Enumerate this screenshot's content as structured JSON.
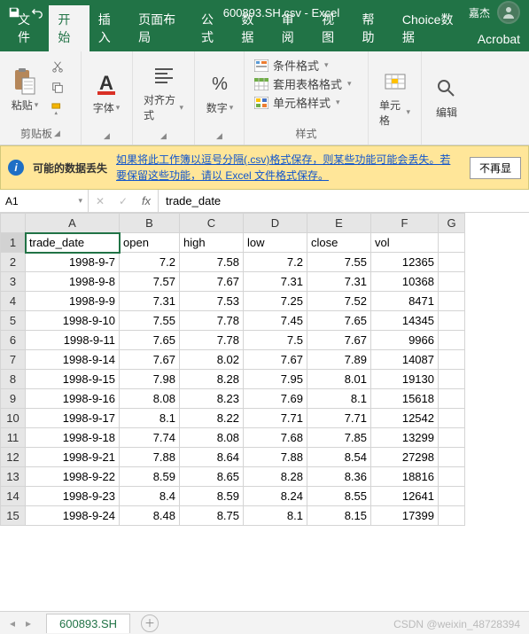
{
  "title": "600893.SH.csv - Excel",
  "user_name": "嘉杰",
  "tabs": [
    "文件",
    "开始",
    "插入",
    "页面布局",
    "公式",
    "数据",
    "审阅",
    "视图",
    "帮助",
    "Choice数据",
    "Acrobat"
  ],
  "active_tab_index": 1,
  "ribbon": {
    "clipboard": {
      "paste": "粘贴",
      "label": "剪贴板"
    },
    "font": {
      "label": "字体"
    },
    "align": {
      "label": "对齐方式"
    },
    "number": {
      "label": "数字"
    },
    "styles": {
      "cond": "条件格式",
      "table": "套用表格格式",
      "cell": "单元格样式",
      "label": "样式"
    },
    "cells": {
      "label": "单元格"
    },
    "edit": {
      "label": "编辑"
    }
  },
  "warning": {
    "title": "可能的数据丢失",
    "text": "如果将此工作簿以逗号分隔(.csv)格式保存，则某些功能可能会丢失。若要保留这些功能，请以 Excel 文件格式保存。",
    "button": "不再显"
  },
  "name_box": "A1",
  "formula_value": "trade_date",
  "columns": [
    "A",
    "B",
    "C",
    "D",
    "E",
    "F",
    "G"
  ],
  "headers": [
    "trade_date",
    "open",
    "high",
    "low",
    "close",
    "vol"
  ],
  "rows": [
    {
      "n": 1,
      "c": [
        "trade_date",
        "open",
        "high",
        "low",
        "close",
        "vol",
        ""
      ],
      "t": [
        "txt",
        "txt",
        "txt",
        "txt",
        "txt",
        "txt",
        "txt"
      ]
    },
    {
      "n": 2,
      "c": [
        "1998-9-7",
        "7.2",
        "7.58",
        "7.2",
        "7.55",
        "12365",
        ""
      ],
      "t": [
        "num",
        "num",
        "num",
        "num",
        "num",
        "num",
        "txt"
      ]
    },
    {
      "n": 3,
      "c": [
        "1998-9-8",
        "7.57",
        "7.67",
        "7.31",
        "7.31",
        "10368",
        ""
      ],
      "t": [
        "num",
        "num",
        "num",
        "num",
        "num",
        "num",
        "txt"
      ]
    },
    {
      "n": 4,
      "c": [
        "1998-9-9",
        "7.31",
        "7.53",
        "7.25",
        "7.52",
        "8471",
        ""
      ],
      "t": [
        "num",
        "num",
        "num",
        "num",
        "num",
        "num",
        "txt"
      ]
    },
    {
      "n": 5,
      "c": [
        "1998-9-10",
        "7.55",
        "7.78",
        "7.45",
        "7.65",
        "14345",
        ""
      ],
      "t": [
        "num",
        "num",
        "num",
        "num",
        "num",
        "num",
        "txt"
      ]
    },
    {
      "n": 6,
      "c": [
        "1998-9-11",
        "7.65",
        "7.78",
        "7.5",
        "7.67",
        "9966",
        ""
      ],
      "t": [
        "num",
        "num",
        "num",
        "num",
        "num",
        "num",
        "txt"
      ]
    },
    {
      "n": 7,
      "c": [
        "1998-9-14",
        "7.67",
        "8.02",
        "7.67",
        "7.89",
        "14087",
        ""
      ],
      "t": [
        "num",
        "num",
        "num",
        "num",
        "num",
        "num",
        "txt"
      ]
    },
    {
      "n": 8,
      "c": [
        "1998-9-15",
        "7.98",
        "8.28",
        "7.95",
        "8.01",
        "19130",
        ""
      ],
      "t": [
        "num",
        "num",
        "num",
        "num",
        "num",
        "num",
        "txt"
      ]
    },
    {
      "n": 9,
      "c": [
        "1998-9-16",
        "8.08",
        "8.23",
        "7.69",
        "8.1",
        "15618",
        ""
      ],
      "t": [
        "num",
        "num",
        "num",
        "num",
        "num",
        "num",
        "txt"
      ]
    },
    {
      "n": 10,
      "c": [
        "1998-9-17",
        "8.1",
        "8.22",
        "7.71",
        "7.71",
        "12542",
        ""
      ],
      "t": [
        "num",
        "num",
        "num",
        "num",
        "num",
        "num",
        "txt"
      ]
    },
    {
      "n": 11,
      "c": [
        "1998-9-18",
        "7.74",
        "8.08",
        "7.68",
        "7.85",
        "13299",
        ""
      ],
      "t": [
        "num",
        "num",
        "num",
        "num",
        "num",
        "num",
        "txt"
      ]
    },
    {
      "n": 12,
      "c": [
        "1998-9-21",
        "7.88",
        "8.64",
        "7.88",
        "8.54",
        "27298",
        ""
      ],
      "t": [
        "num",
        "num",
        "num",
        "num",
        "num",
        "num",
        "txt"
      ]
    },
    {
      "n": 13,
      "c": [
        "1998-9-22",
        "8.59",
        "8.65",
        "8.28",
        "8.36",
        "18816",
        ""
      ],
      "t": [
        "num",
        "num",
        "num",
        "num",
        "num",
        "num",
        "txt"
      ]
    },
    {
      "n": 14,
      "c": [
        "1998-9-23",
        "8.4",
        "8.59",
        "8.24",
        "8.55",
        "12641",
        ""
      ],
      "t": [
        "num",
        "num",
        "num",
        "num",
        "num",
        "num",
        "txt"
      ]
    },
    {
      "n": 15,
      "c": [
        "1998-9-24",
        "8.48",
        "8.75",
        "8.1",
        "8.15",
        "17399",
        ""
      ],
      "t": [
        "num",
        "num",
        "num",
        "num",
        "num",
        "num",
        "txt"
      ]
    }
  ],
  "selected_cell": "A1",
  "sheet_name": "600893.SH",
  "watermark": "CSDN @weixin_48728394"
}
